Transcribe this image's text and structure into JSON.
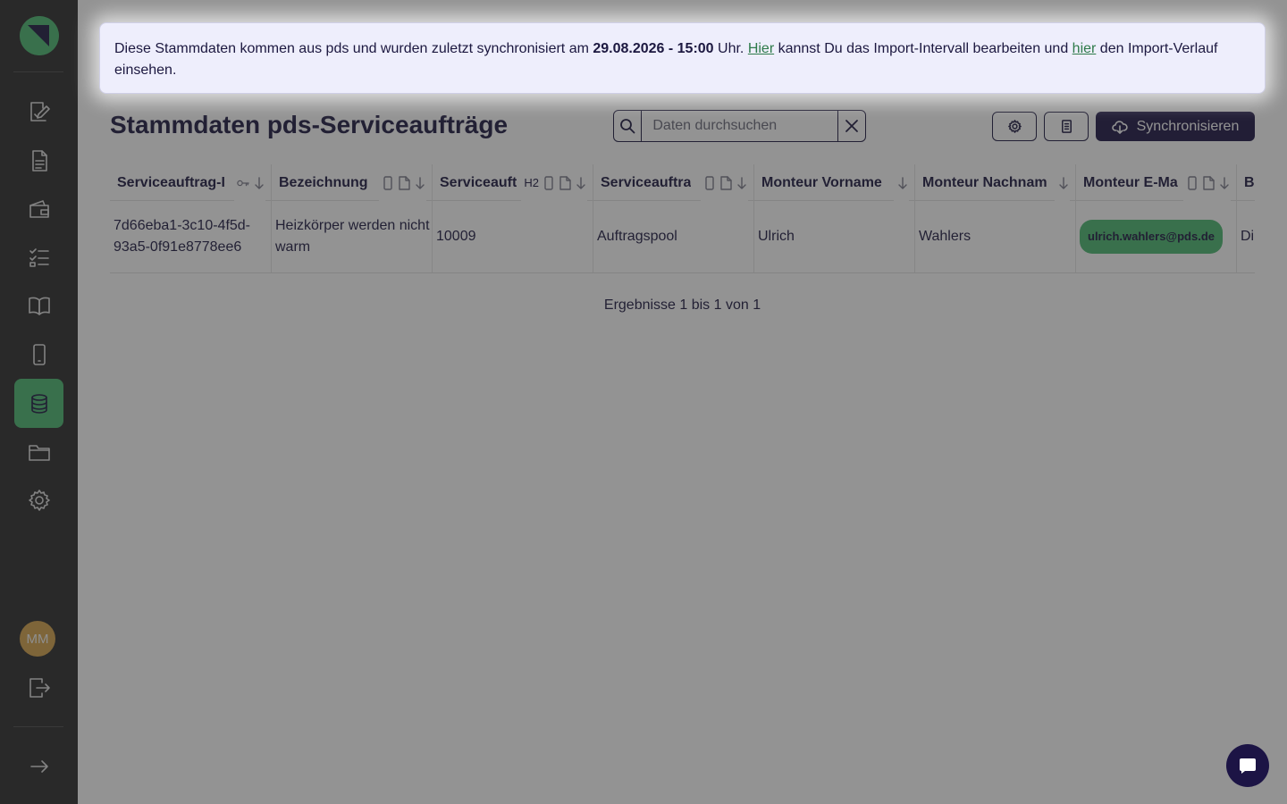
{
  "sidebar": {
    "logo_name": "app-logo",
    "items": [
      {
        "name": "edit-icon"
      },
      {
        "name": "document-icon"
      },
      {
        "name": "wallet-icon"
      },
      {
        "name": "checklist-icon"
      },
      {
        "name": "book-icon"
      },
      {
        "name": "mobile-icon"
      },
      {
        "name": "database-icon",
        "active": true
      },
      {
        "name": "folder-icon"
      },
      {
        "name": "gear-icon"
      }
    ],
    "avatar_initials": "MM",
    "logout_icon": "logout-icon",
    "expand_icon": "arrow-right-icon"
  },
  "banner": {
    "text_before": "Diese Stammdaten kommen aus pds und wurden zuletzt synchronisiert am ",
    "sync_time": "29.08.2026 - 15:00",
    "text_mid1": " Uhr. ",
    "link1": "Hier",
    "text_mid2": " kannst Du das Import-Intervall bearbeiten und ",
    "link2": "hier",
    "text_after": " den Import-Verlauf einsehen."
  },
  "page": {
    "title": "Stammdaten pds-Serviceaufträge"
  },
  "search": {
    "placeholder": "Daten durchsuchen"
  },
  "toolbar": {
    "sync_label": "Synchronisieren"
  },
  "table": {
    "columns": [
      {
        "label": "Serviceauftrag-I"
      },
      {
        "label": "Bezeichnung"
      },
      {
        "label": "Serviceauft",
        "extra": "H2"
      },
      {
        "label": "Serviceauftra"
      },
      {
        "label": "Monteur Vorname"
      },
      {
        "label": "Monteur Nachnam"
      },
      {
        "label": "Monteur E-Ma"
      },
      {
        "label": "Be"
      }
    ],
    "rows": [
      {
        "id": "7d66eba1-3c10-4f5d-93a5-0f91e8778ee6",
        "bezeichnung": "Heizkörper werden nicht warm",
        "nummer": "10009",
        "status": "Auftragspool",
        "vorname": "Ulrich",
        "nachname": "Wahlers",
        "email": "ulrich.wahlers@pds.de",
        "extra": "Di"
      }
    ]
  },
  "results_text": "Ergebnisse 1 bis 1 von 1",
  "colors": {
    "sidebar_bg": "#2a2a2a",
    "accent_green": "#4ab870",
    "primary_navy": "#1c1445",
    "banner_bg": "#eeeefc"
  }
}
